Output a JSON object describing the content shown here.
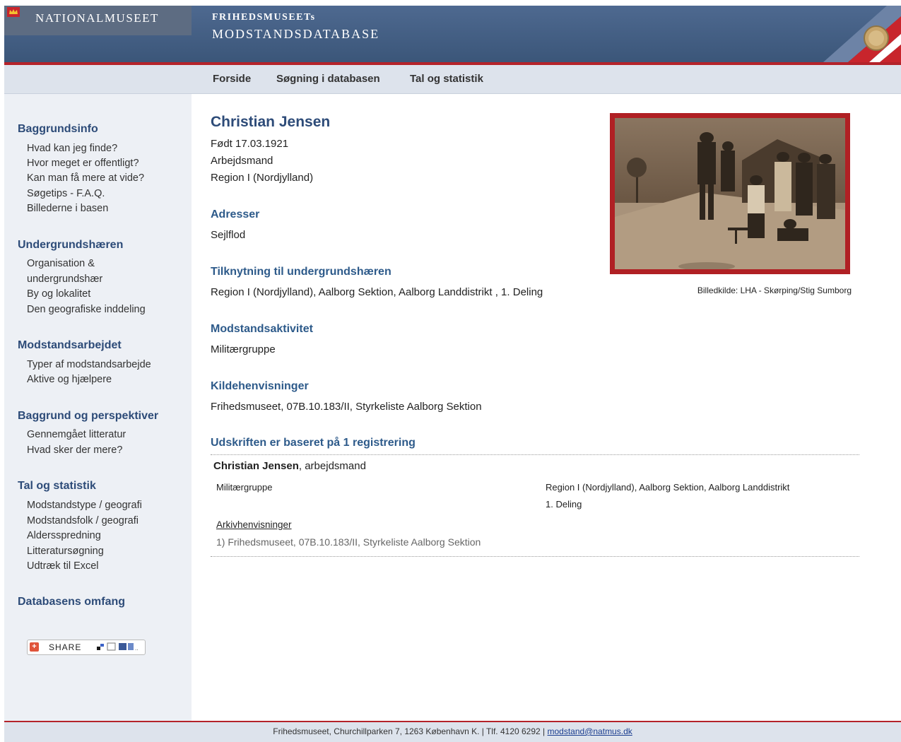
{
  "header": {
    "museum_name": "NATIONALMUSEET",
    "db_title_line1": "FRIHEDSMUSEETs",
    "db_title_line2": "MODSTANDSDATABASE"
  },
  "nav": [
    "Forside",
    "Søgning i databasen",
    "Tal og statistik"
  ],
  "sidebar": {
    "sections": [
      {
        "heading": "Baggrundsinfo",
        "links": [
          "Hvad kan jeg finde?",
          "Hvor meget er offentligt?",
          "Kan man få mere at vide?",
          "Søgetips - F.A.Q.",
          "Billederne i basen"
        ]
      },
      {
        "heading": "Undergrundshæren",
        "links": [
          "Organisation &",
          "undergrundshær",
          "By og lokalitet",
          "Den geografiske inddeling"
        ]
      },
      {
        "heading": "Modstandsarbejdet",
        "links": [
          "Typer af modstandsarbejde",
          "Aktive og hjælpere"
        ]
      },
      {
        "heading": "Baggrund og perspektiver",
        "links": [
          "Gennemgået litteratur",
          "Hvad sker der mere?"
        ]
      },
      {
        "heading": "Tal og statistik",
        "links": [
          "Modstandstype / geografi",
          "Modstandsfolk / geografi",
          "Aldersspredning",
          "Litteratursøgning",
          "Udtræk til Excel"
        ]
      },
      {
        "heading": "Databasens omfang",
        "links": []
      }
    ],
    "share_label": "SHARE"
  },
  "person": {
    "name": "Christian Jensen",
    "born": "Født 17.03.1921",
    "occupation": "Arbejdsmand",
    "region": "Region I (Nordjylland)"
  },
  "sections": {
    "addresses_title": "Adresser",
    "addresses": "Sejlflod",
    "affiliation_title": "Tilknytning til undergrundshæren",
    "affiliation": "Region I (Nordjylland), Aalborg Sektion, Aalborg Landdistrikt , 1. Deling",
    "activity_title": "Modstandsaktivitet",
    "activity": "Militærgruppe",
    "sources_title": "Kildehenvisninger",
    "sources": "Frihedsmuseet, 07B.10.183/II, Styrkeliste Aalborg Sektion",
    "registration_title": "Udskriften er baseret på 1 registrering"
  },
  "registration": {
    "name": "Christian Jensen",
    "suffix": ", arbejdsmand",
    "group": "Militærgruppe",
    "unit": "Region I (Nordjylland), Aalborg Sektion, Aalborg Landdistrikt",
    "deling": "1. Deling",
    "archive_link": "Arkivhenvisninger",
    "archive_text": "1) Frihedsmuseet, 07B.10.183/II, Styrkeliste Aalborg Sektion"
  },
  "photo": {
    "caption": "Billedkilde: LHA - Skørping/Stig Sumborg"
  },
  "footer": {
    "text": "Frihedsmuseet, Churchillparken 7, 1263 København K. | Tlf. 4120 6292 | ",
    "email": "modstand@natmus.dk"
  }
}
